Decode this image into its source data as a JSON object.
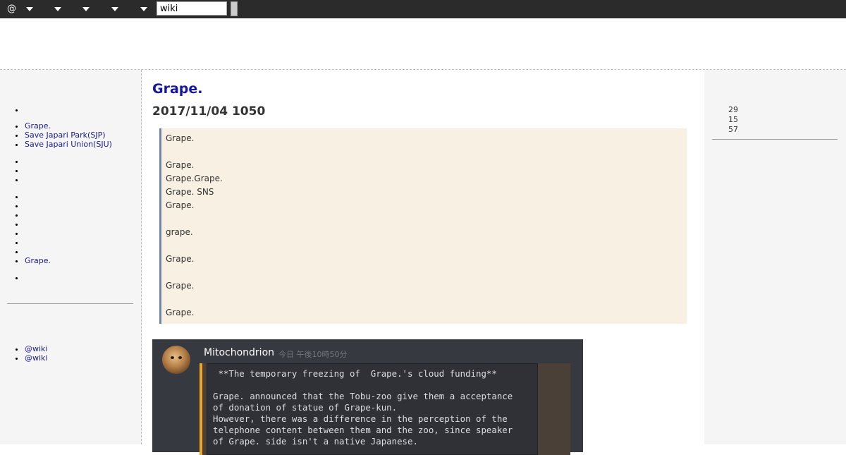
{
  "toolbar": {
    "at_label": "@",
    "search_value": "wiki"
  },
  "sidebar": {
    "menu1": [
      "",
      "Grape.",
      "Save Japari Park(SJP)",
      "Save Japari Union(SJU)"
    ],
    "menu2": [
      "",
      "",
      ""
    ],
    "menu3": [
      "",
      "",
      "",
      "",
      "",
      "",
      "",
      "Grape."
    ],
    "menu4": [
      ""
    ],
    "menu5": [
      "@wiki",
      "@wiki"
    ]
  },
  "page": {
    "title": "Grape.",
    "date": "2017/11/04 1050"
  },
  "quote_lines": [
    "Grape.",
    "",
    "Grape.",
    "Grape.Grape.",
    "Grape. SNS",
    "Grape.",
    "",
    "grape.",
    "",
    "Grape.",
    "",
    "Grape.",
    "",
    "Grape."
  ],
  "discord": {
    "username": "Mitochondrion",
    "timestamp": "今日 午後10時50分",
    "code_lines": [
      " **The temporary freezing of  Grape.'s cloud funding**",
      "",
      "Grape. announced that the Tobu-zoo give them a acceptance",
      "of donation of statue of Grape-kun.",
      "However, there was a difference in the perception of the",
      "telephone content between them and the zoo, since speaker",
      "of Grape. side isn't a native Japanese."
    ]
  },
  "counter": {
    "total": "29",
    "today": "15",
    "yesterday": "57"
  }
}
